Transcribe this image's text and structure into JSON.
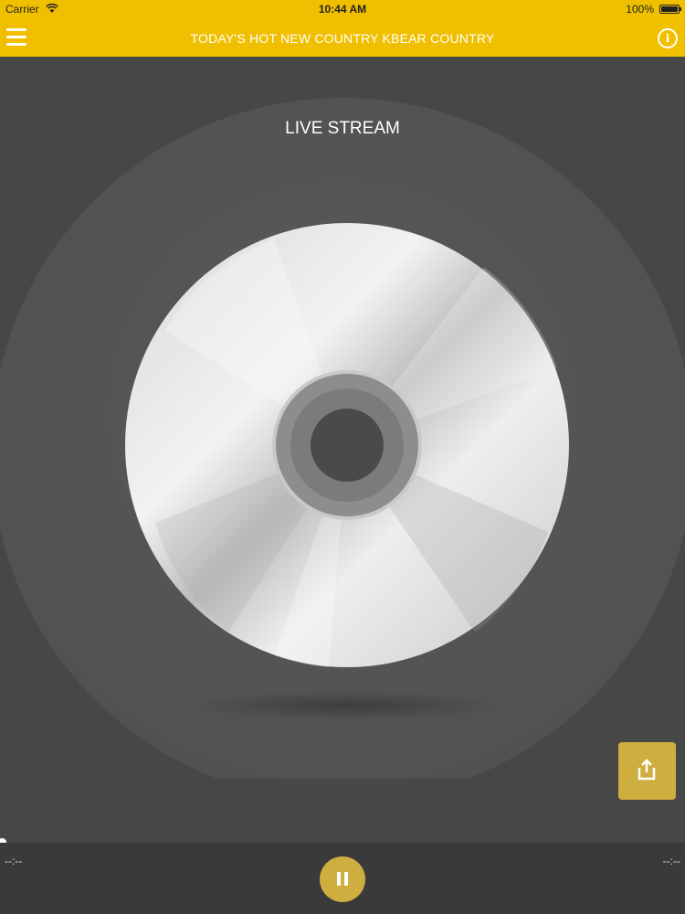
{
  "status_bar": {
    "carrier": "Carrier",
    "time": "10:44 AM",
    "battery": "100%"
  },
  "nav": {
    "title": "TODAY'S HOT NEW COUNTRY KBEAR COUNTRY",
    "info_glyph": "i"
  },
  "player": {
    "stream_label": "LIVE STREAM",
    "elapsed": "--:--",
    "remaining": "--:--"
  },
  "icons": {
    "menu": "hamburger-menu-icon",
    "info": "info-icon",
    "share": "share-icon",
    "pause": "pause-icon",
    "wifi": "wifi-icon",
    "battery": "battery-icon"
  },
  "colors": {
    "accent": "#f0c000",
    "button": "#cfae40",
    "background": "#474748",
    "player_bar": "#3a3a3b"
  }
}
